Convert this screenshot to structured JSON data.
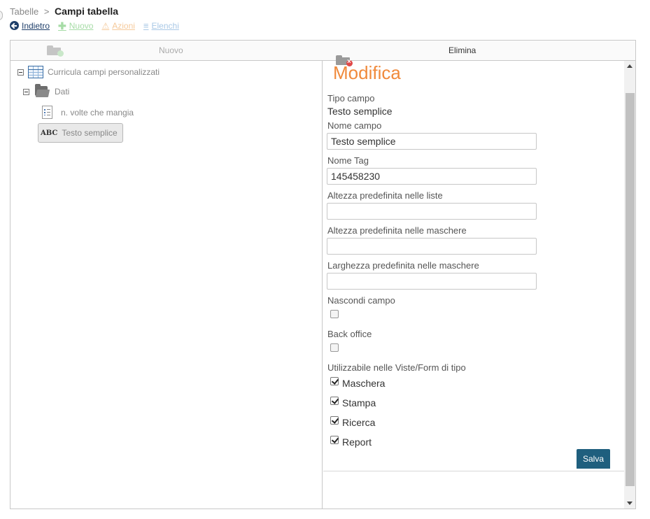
{
  "breadcrumb": {
    "parent": "Tabelle",
    "separator": ">",
    "current": "Campi tabella"
  },
  "actions": {
    "back": "Indietro",
    "new": "Nuovo",
    "azioni": "Azioni",
    "elenchi": "Elenchi"
  },
  "toolbar": {
    "new_label": "Nuovo",
    "delete_label": "Elimina"
  },
  "tree": {
    "root": "Curricula campi personalizzati",
    "folder": "Dati",
    "fields": [
      "n. volte che mangia",
      "Testo semplice"
    ],
    "selected_icon_text": "ABC"
  },
  "form": {
    "title": "Modifica",
    "tipo_campo_label": "Tipo campo",
    "tipo_campo_value": "Testo semplice",
    "nome_campo_label": "Nome campo",
    "nome_campo_value": "Testo semplice",
    "nome_tag_label": "Nome Tag",
    "nome_tag_value": "145458230",
    "altezza_liste_label": "Altezza predefinita nelle liste",
    "altezza_liste_value": "",
    "altezza_maschere_label": "Altezza predefinita nelle maschere",
    "altezza_maschere_value": "",
    "larghezza_maschere_label": "Larghezza predefinita nelle maschere",
    "larghezza_maschere_value": "",
    "nascondi_label": "Nascondi campo",
    "nascondi_checked": false,
    "back_office_label": "Back office",
    "back_office_checked": false,
    "utilizzabile_label": "Utilizzabile nelle Viste/Form di tipo",
    "view_types": [
      {
        "label": "Maschera",
        "checked": true
      },
      {
        "label": "Stampa",
        "checked": true
      },
      {
        "label": "Ricerca",
        "checked": true
      },
      {
        "label": "Report",
        "checked": true
      }
    ],
    "save_label": "Salva"
  },
  "colors": {
    "accent": "#f08a3c",
    "primary_button": "#1f5f7e",
    "link": "#1f3f6a"
  }
}
